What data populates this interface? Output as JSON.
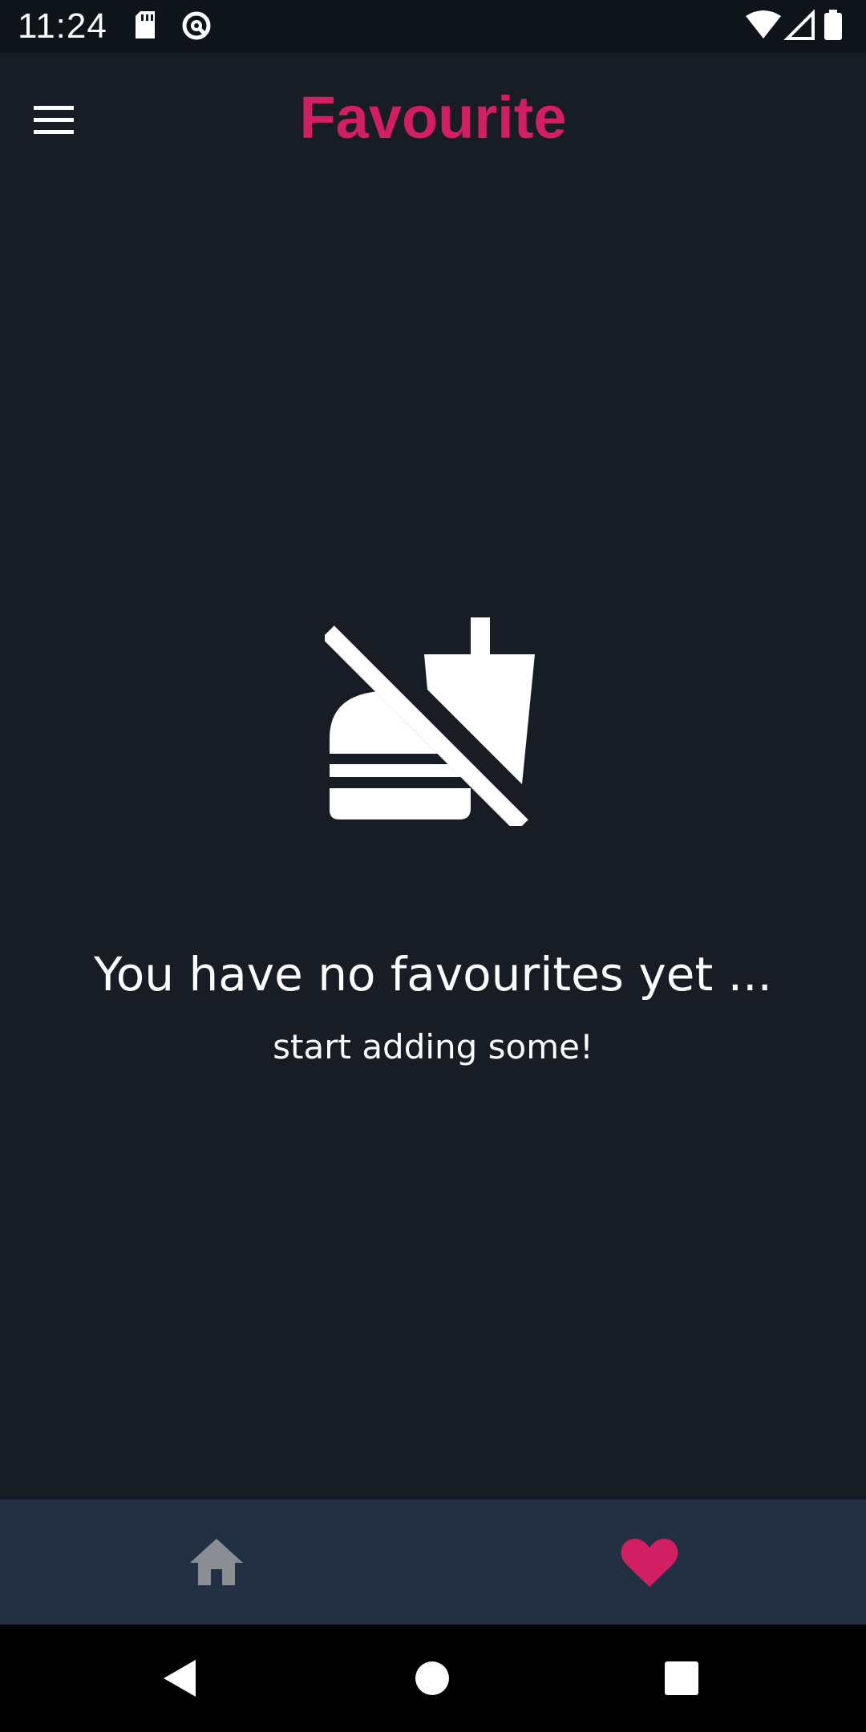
{
  "status_bar": {
    "time": "11:24"
  },
  "app_bar": {
    "title": "Favourite",
    "menu_icon": "menu-icon"
  },
  "empty_state": {
    "icon": "no-food-icon",
    "title": "You have no favourites yet ...",
    "subtitle": "start adding some!"
  },
  "bottom_nav": {
    "items": [
      {
        "icon": "home-icon",
        "active": false
      },
      {
        "icon": "heart-icon",
        "active": true
      }
    ]
  },
  "colors": {
    "background": "#171c25",
    "accent": "#d21f62",
    "bottom_nav_bg": "#233044",
    "inactive_icon": "#8a8d92",
    "text": "#ffffff"
  }
}
